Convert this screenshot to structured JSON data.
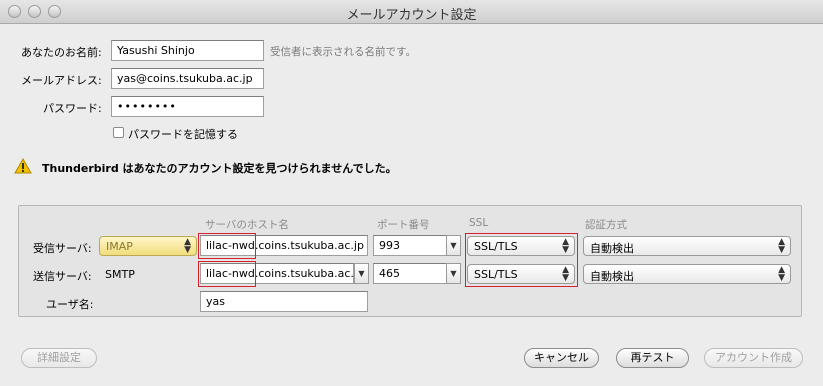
{
  "window": {
    "title": "メールアカウント設定"
  },
  "form": {
    "name_label": "あなたのお名前:",
    "name_value": "Yasushi Shinjo",
    "name_hint": "受信者に表示される名前です。",
    "email_label": "メールアドレス:",
    "email_value": "yas@coins.tsukuba.ac.jp",
    "password_label": "パスワード:",
    "password_value": "••••••••",
    "remember_label": "パスワードを記憶する"
  },
  "warning": {
    "text": "Thunderbird はあなたのアカウント設定を見つけられませんでした。"
  },
  "server_table": {
    "headers": {
      "hostname": "サーバのホスト名",
      "port": "ポート番号",
      "ssl": "SSL",
      "auth": "認証方式"
    },
    "incoming": {
      "label": "受信サーバ:",
      "protocol": "IMAP",
      "host": "lilac-nwd.coins.tsukuba.ac.jp",
      "port": "993",
      "ssl": "SSL/TLS",
      "auth": "自動検出"
    },
    "outgoing": {
      "label": "送信サーバ:",
      "protocol": "SMTP",
      "host": "lilac-nwd.coins.tsukuba.ac.",
      "port": "465",
      "ssl": "SSL/TLS",
      "auth": "自動検出"
    },
    "username": {
      "label": "ユーザ名:",
      "value": "yas"
    }
  },
  "buttons": {
    "advanced": "詳細設定",
    "cancel": "キャンセル",
    "retest": "再テスト",
    "create": "アカウント作成"
  }
}
